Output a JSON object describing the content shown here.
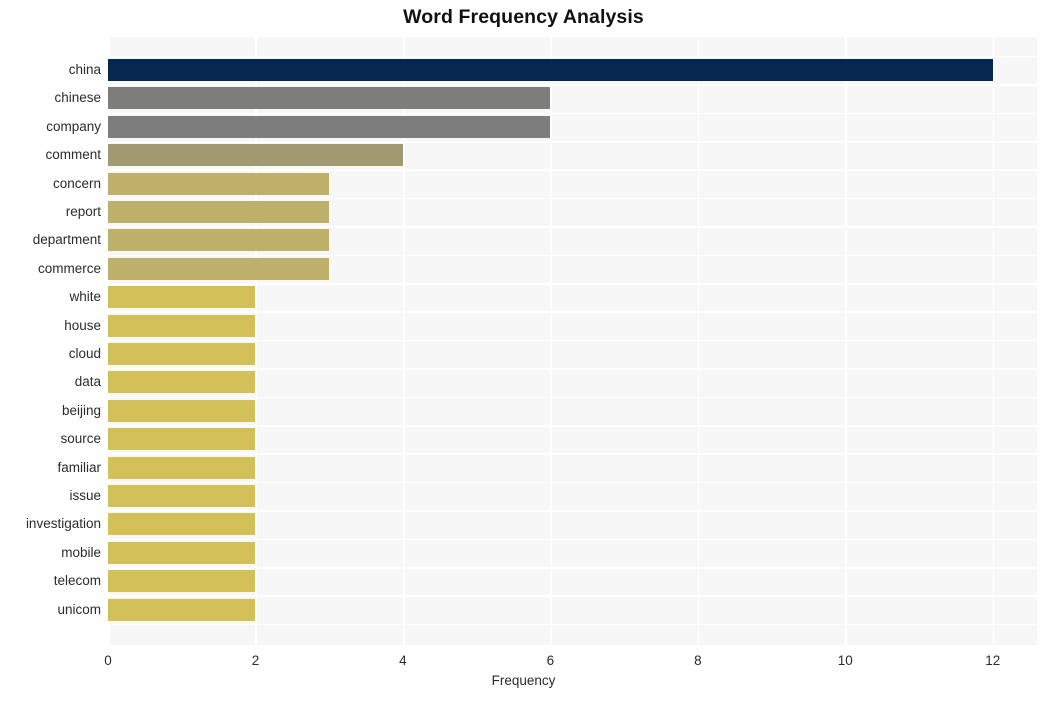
{
  "chart_data": {
    "type": "bar",
    "orientation": "horizontal",
    "title": "Word Frequency Analysis",
    "xlabel": "Frequency",
    "ylabel": "",
    "xlim": [
      0,
      12.6
    ],
    "xticks": [
      0,
      2,
      4,
      6,
      8,
      10,
      12
    ],
    "xtick_labels": [
      "0",
      "2",
      "4",
      "6",
      "8",
      "10",
      "12"
    ],
    "grid": true,
    "legend": "none",
    "categories": [
      "china",
      "chinese",
      "company",
      "comment",
      "concern",
      "report",
      "department",
      "commerce",
      "white",
      "house",
      "cloud",
      "data",
      "beijing",
      "source",
      "familiar",
      "issue",
      "investigation",
      "mobile",
      "telecom",
      "unicom"
    ],
    "values": [
      12,
      6,
      6,
      4,
      3,
      3,
      3,
      3,
      2,
      2,
      2,
      2,
      2,
      2,
      2,
      2,
      2,
      2,
      2,
      2
    ],
    "bar_colors": [
      "#05264f",
      "#7d7d7b",
      "#7d7d7b",
      "#a29a73",
      "#bdb06a",
      "#bdb06a",
      "#bdb06a",
      "#bdb06a",
      "#d2c159",
      "#d2c159",
      "#d2c159",
      "#d2c159",
      "#d2c159",
      "#d2c159",
      "#d2c159",
      "#d2c159",
      "#d2c159",
      "#d2c159",
      "#d2c159",
      "#d2c159"
    ]
  },
  "theme": {
    "plot_background": "#f7f7f7",
    "figure_background": "#ffffff",
    "grid_color": "#ffffff",
    "text_color": "#2b2b2b",
    "title_color": "#111111"
  }
}
